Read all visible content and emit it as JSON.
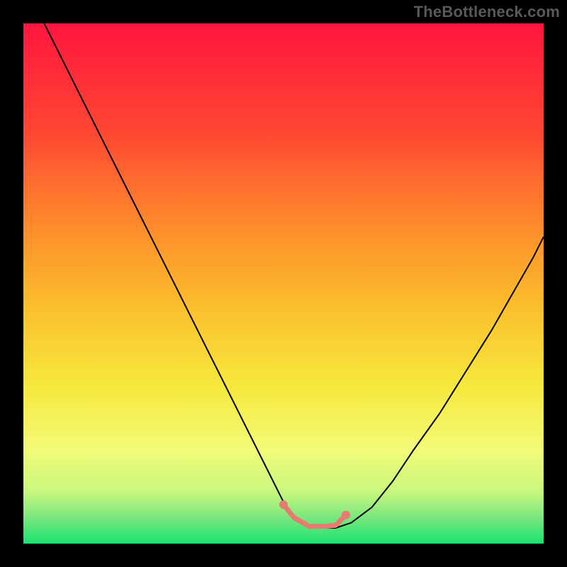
{
  "watermark": "TheBottleneck.com",
  "chart_data": {
    "type": "line",
    "title": "",
    "xlabel": "",
    "ylabel": "",
    "xlim": [
      0,
      100
    ],
    "ylim": [
      0,
      100
    ],
    "background": {
      "type": "vertical-gradient",
      "stops": [
        {
          "offset": 0.0,
          "color": "#ff163f"
        },
        {
          "offset": 0.2,
          "color": "#ff4433"
        },
        {
          "offset": 0.4,
          "color": "#fd8f2b"
        },
        {
          "offset": 0.55,
          "color": "#fbc02d"
        },
        {
          "offset": 0.7,
          "color": "#f6e93d"
        },
        {
          "offset": 0.82,
          "color": "#f3fa78"
        },
        {
          "offset": 0.9,
          "color": "#c8f77d"
        },
        {
          "offset": 0.95,
          "color": "#7ae77e"
        },
        {
          "offset": 1.0,
          "color": "#19e36f"
        }
      ]
    },
    "series": [
      {
        "name": "bottleneck-curve",
        "color": "#000000",
        "width": 2,
        "x": [
          4,
          8,
          12,
          16,
          20,
          24,
          28,
          32,
          36,
          40,
          44,
          48,
          50,
          52,
          55,
          58,
          60,
          63,
          67,
          71,
          75,
          80,
          85,
          90,
          94,
          98,
          100
        ],
        "y": [
          100,
          92,
          84,
          76,
          68,
          60,
          52,
          44,
          36,
          28,
          20,
          12,
          8,
          5,
          3,
          3,
          3,
          4,
          7,
          12,
          18,
          25,
          33,
          41,
          48,
          55,
          59
        ]
      },
      {
        "name": "optimal-band",
        "color": "#e77a72",
        "width": 7,
        "linecap": "round",
        "x": [
          50,
          52,
          55,
          58,
          60,
          62
        ],
        "y": [
          7.5,
          5,
          3.3,
          3.3,
          3.5,
          5.5
        ]
      }
    ],
    "markers": [
      {
        "name": "optimal-start",
        "x": 50,
        "y": 7.5,
        "r": 6,
        "color": "#e77a72"
      },
      {
        "name": "optimal-end",
        "x": 62,
        "y": 5.5,
        "r": 6,
        "color": "#e77a72"
      }
    ]
  }
}
